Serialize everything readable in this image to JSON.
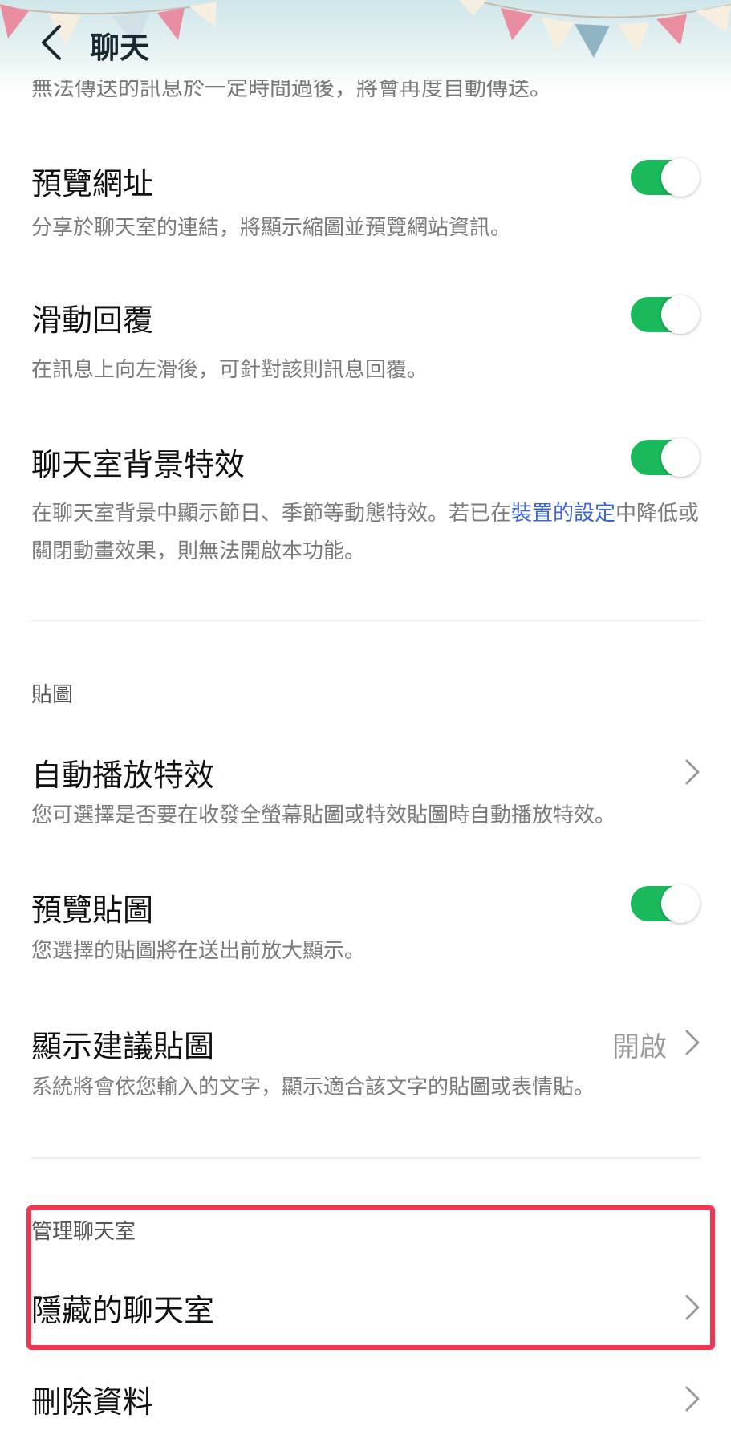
{
  "header": {
    "title": "聊天",
    "back_icon": "chevron-left-icon",
    "decoration": "bunting-pennants"
  },
  "cut_off_text": "無法傳送的訊息於一定時間過後，將會再度自動傳送。",
  "settings": {
    "url_preview": {
      "title": "預覽網址",
      "desc": "分享於聊天室的連結，將顯示縮圖並預覽網站資訊。",
      "enabled": true
    },
    "swipe_reply": {
      "title": "滑動回覆",
      "desc": "在訊息上向左滑後，可針對該則訊息回覆。",
      "enabled": true
    },
    "bg_effects": {
      "title": "聊天室背景特效",
      "desc_part1": "在聊天室背景中顯示節日、季節等動態特效。若已在",
      "desc_link": "裝置的設定",
      "desc_part2": "中降低或關閉動畫效果，則無法開啟本功能。",
      "enabled": true
    }
  },
  "stickers": {
    "section_label": "貼圖",
    "auto_play": {
      "title": "自動播放特效",
      "desc": "您可選擇是否要在收發全螢幕貼圖或特效貼圖時自動播放特效。"
    },
    "preview": {
      "title": "預覽貼圖",
      "desc": "您選擇的貼圖將在送出前放大顯示。",
      "enabled": true
    },
    "suggest": {
      "title": "顯示建議貼圖",
      "value": "開啟",
      "desc": "系統將會依您輸入的文字，顯示適合該文字的貼圖或表情貼。"
    }
  },
  "manage": {
    "section_label": "管理聊天室",
    "hidden_chats": {
      "title": "隱藏的聊天室"
    },
    "delete_data": {
      "title": "刪除資料"
    }
  },
  "colors": {
    "toggle_on": "#19b95c",
    "link": "#3a64d8",
    "highlight_border": "#f2364f"
  }
}
